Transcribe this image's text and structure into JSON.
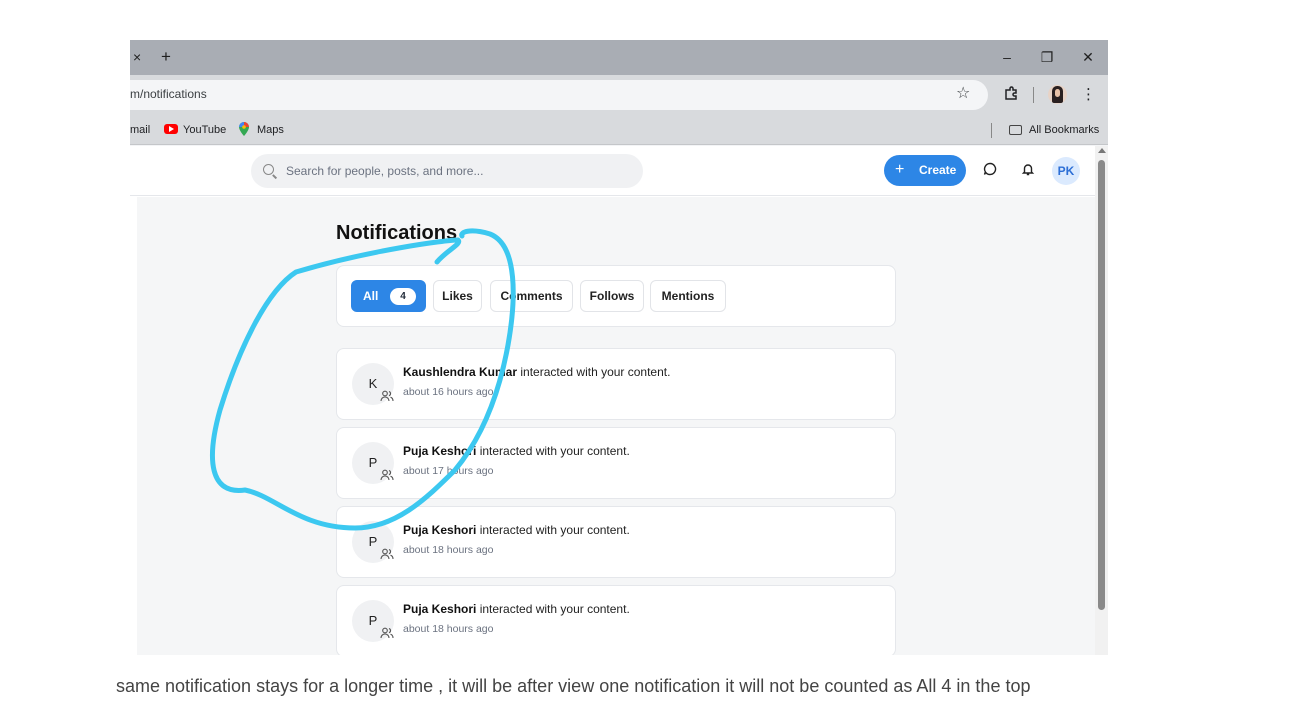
{
  "browser": {
    "tab_close_glyph": "×",
    "new_tab_glyph": "+",
    "minimize_glyph": "–",
    "restore_glyph": "❐",
    "close_glyph": "✕",
    "url": "m/notifications",
    "bookmarks": [
      {
        "label": "mail",
        "icon": "mail-icon"
      },
      {
        "label": "YouTube",
        "icon": "youtube-icon"
      },
      {
        "label": "Maps",
        "icon": "maps-icon"
      }
    ],
    "all_bookmarks_label": "All Bookmarks"
  },
  "app": {
    "search_placeholder": "Search for people, posts, and more...",
    "create_label": "Create",
    "create_plus": "+",
    "user_initials": "PK",
    "page_title": "Notifications",
    "filters": [
      {
        "label": "All",
        "count": "4",
        "active": true
      },
      {
        "label": "Likes"
      },
      {
        "label": "Comments"
      },
      {
        "label": "Follows"
      },
      {
        "label": "Mentions"
      }
    ],
    "notifications": [
      {
        "initial": "K",
        "name": "Kaushlendra Kumar",
        "action": " interacted with your content.",
        "time": "about 16 hours ago"
      },
      {
        "initial": "P",
        "name": "Puja Keshori",
        "action": " interacted with your content.",
        "time": "about 17 hours ago"
      },
      {
        "initial": "P",
        "name": "Puja Keshori",
        "action": " interacted with your content.",
        "time": "about 18 hours ago"
      },
      {
        "initial": "P",
        "name": "Puja Keshori",
        "action": " interacted with your content.",
        "time": "about 18 hours ago"
      }
    ]
  },
  "colors": {
    "accent": "#2d86e6",
    "annotation": "#3cc8f0"
  },
  "caption": "same notification stays for a longer time , it will be after view one notification it will not be counted as All 4 in the top"
}
